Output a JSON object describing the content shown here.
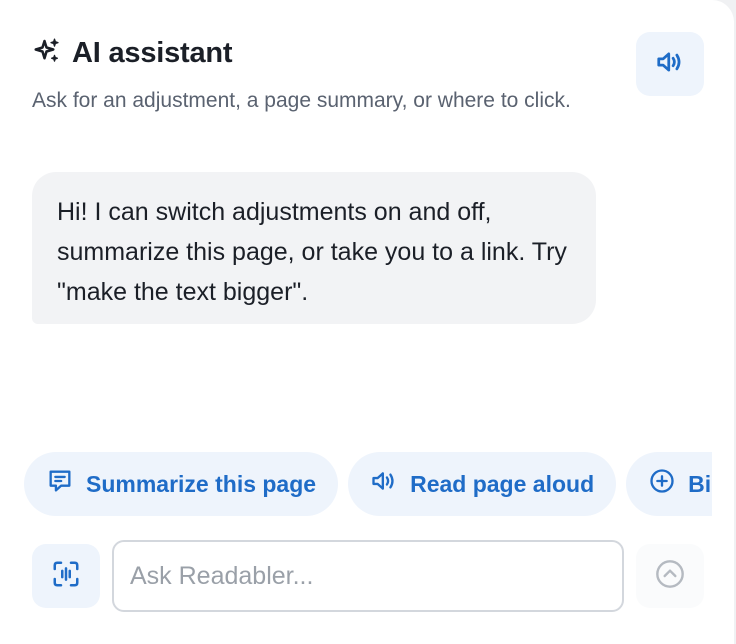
{
  "header": {
    "title": "AI assistant",
    "subtitle": "Ask for an adjustment, a page summary, or where to click.",
    "icon": "sparkles-icon",
    "speaker_icon": "speaker-icon"
  },
  "messages": [
    {
      "role": "assistant",
      "text": "Hi! I can switch adjustments on and off, summarize this page, or take you to a link. Try \"make the text bigger\"."
    }
  ],
  "suggestions": [
    {
      "label": "Summarize this page",
      "icon": "message-icon"
    },
    {
      "label": "Read page aloud",
      "icon": "speaker-icon"
    },
    {
      "label": "Big",
      "icon": "plus-circle-icon"
    }
  ],
  "composer": {
    "placeholder": "Ask Readabler...",
    "value": "",
    "mic_icon": "voice-icon",
    "send_icon": "arrow-up-circle-icon"
  },
  "colors": {
    "accent": "#1f6cc7",
    "chip_background": "#eef4fc",
    "bubble_background": "#f2f3f5",
    "title_text": "#1b1f27",
    "subtle_text": "#5a6270"
  }
}
